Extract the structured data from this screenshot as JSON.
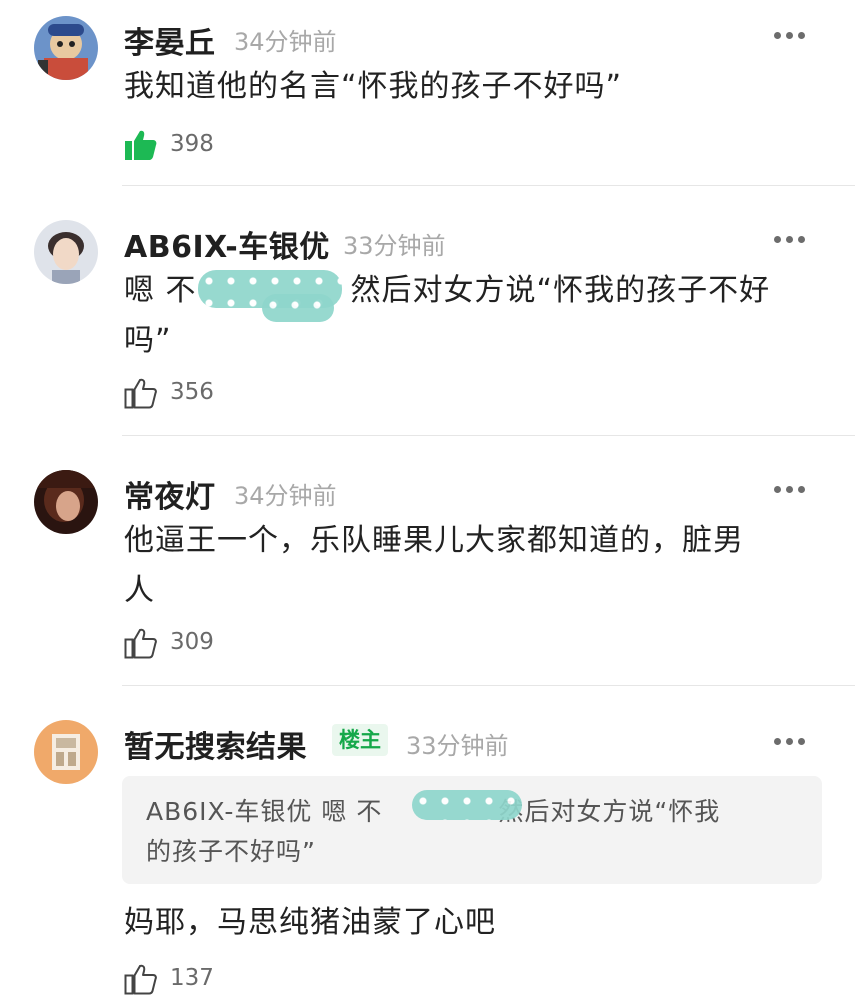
{
  "comments": [
    {
      "user": "李晏丘",
      "time": "34分钟前",
      "text": "我知道他的名言“怀我的孩子不好吗”",
      "likes": "398",
      "liked": true,
      "avatar": "avatar-cartoon-character"
    },
    {
      "user": "AB6IX-车银优",
      "time": "33分钟前",
      "text_before_blur": "嗯 不",
      "text_after_blur": "然后对女方说“怀我的孩子不好",
      "text_line2": "吗”",
      "likes": "356",
      "liked": false,
      "avatar": "avatar-young-man"
    },
    {
      "user": "常夜灯",
      "time": "34分钟前",
      "text_line1": "他逼王一个，乐队睡果儿大家都知道的，脏男",
      "text_line2": "人",
      "likes": "309",
      "liked": false,
      "avatar": "avatar-dark-portrait"
    },
    {
      "user": "暂无搜索结果",
      "badge": "楼主",
      "time": "33分钟前",
      "quote": {
        "user": "AB6IX-车银优",
        "before_blur": "嗯 不",
        "after_blur": "然后对女方说“怀我",
        "line2": "的孩子不好吗”"
      },
      "text": "妈耶，马思纯猪油蒙了心吧",
      "likes": "137",
      "liked": false,
      "avatar": "avatar-illustration-room"
    }
  ],
  "colors": {
    "like_active": "#1db954",
    "badge_text": "#15a84a",
    "time": "#a8a8a8",
    "blur_overlay": "#8fd6cc"
  },
  "icons": [
    "more-icon",
    "thumbs-up-icon"
  ]
}
